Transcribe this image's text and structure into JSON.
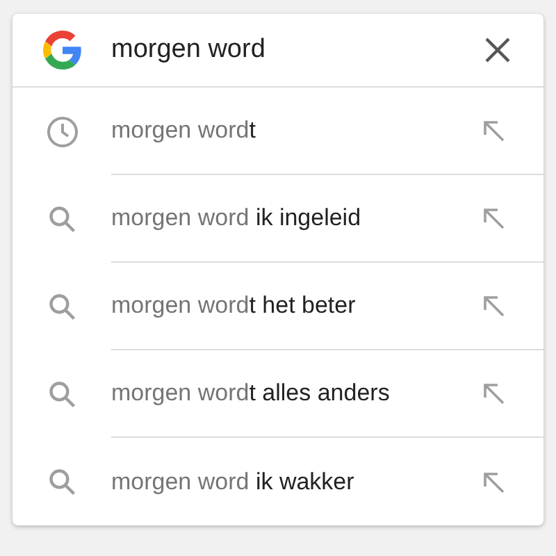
{
  "search": {
    "value": "morgen word"
  },
  "suggestions": [
    {
      "kind": "history",
      "text": "morgen word**t**"
    },
    {
      "kind": "search",
      "text": "morgen word **ik ingeleid**"
    },
    {
      "kind": "search",
      "text": "morgen word**t het beter**"
    },
    {
      "kind": "search",
      "text": "morgen word**t alles anders**"
    },
    {
      "kind": "search",
      "text": "morgen word **ik wakker**"
    }
  ]
}
